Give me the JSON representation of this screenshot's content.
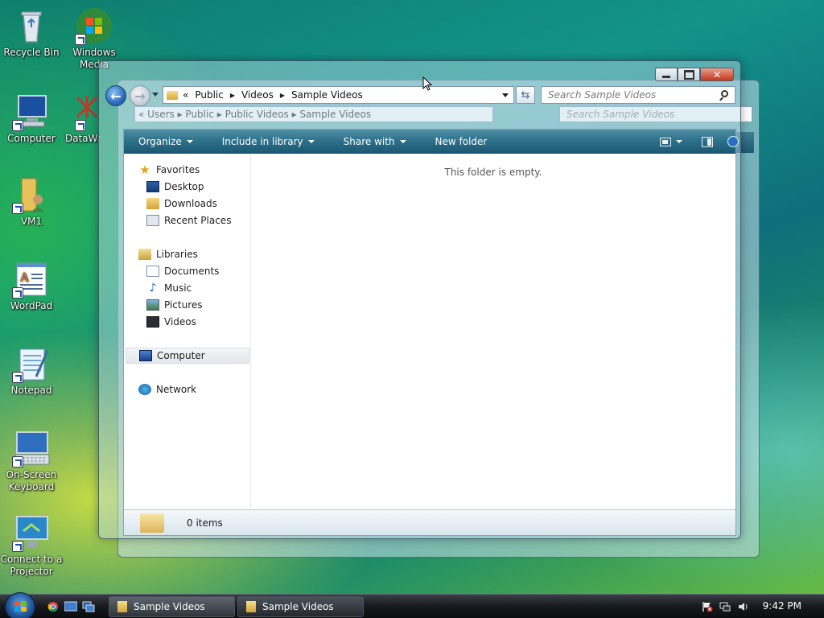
{
  "desktop": {
    "icons": [
      {
        "label": "Recycle Bin"
      },
      {
        "label": "Windows Media Center"
      },
      {
        "label": "Computer"
      },
      {
        "label": "DataWa"
      },
      {
        "label": "VM1"
      },
      {
        "label": "WordPad"
      },
      {
        "label": "Notepad"
      },
      {
        "label": "On-Screen Keyboard"
      },
      {
        "label": "Connect to a Projector"
      }
    ]
  },
  "back_window": {
    "address": "«  Users  ▸  Public  ▸  Public Videos  ▸  Sample Videos",
    "search_placeholder": "Search Sample Videos"
  },
  "window": {
    "address": {
      "overflow": "«",
      "crumbs": [
        "Public",
        "Videos",
        "Sample Videos"
      ]
    },
    "search_placeholder": "Search Sample Videos",
    "toolbar": {
      "organize": "Organize",
      "include_in_library": "Include in library",
      "share_with": "Share with",
      "new_folder": "New folder"
    },
    "nav": {
      "favorites": "Favorites",
      "desktop": "Desktop",
      "downloads": "Downloads",
      "recent_places": "Recent Places",
      "libraries": "Libraries",
      "documents": "Documents",
      "music": "Music",
      "pictures": "Pictures",
      "videos": "Videos",
      "computer": "Computer",
      "network": "Network"
    },
    "empty_message": "This folder is empty.",
    "details": {
      "item_count": "0 items"
    }
  },
  "taskbar": {
    "tasks": [
      {
        "label": "Sample Videos"
      },
      {
        "label": "Sample Videos"
      }
    ],
    "clock": "9:42 PM"
  }
}
